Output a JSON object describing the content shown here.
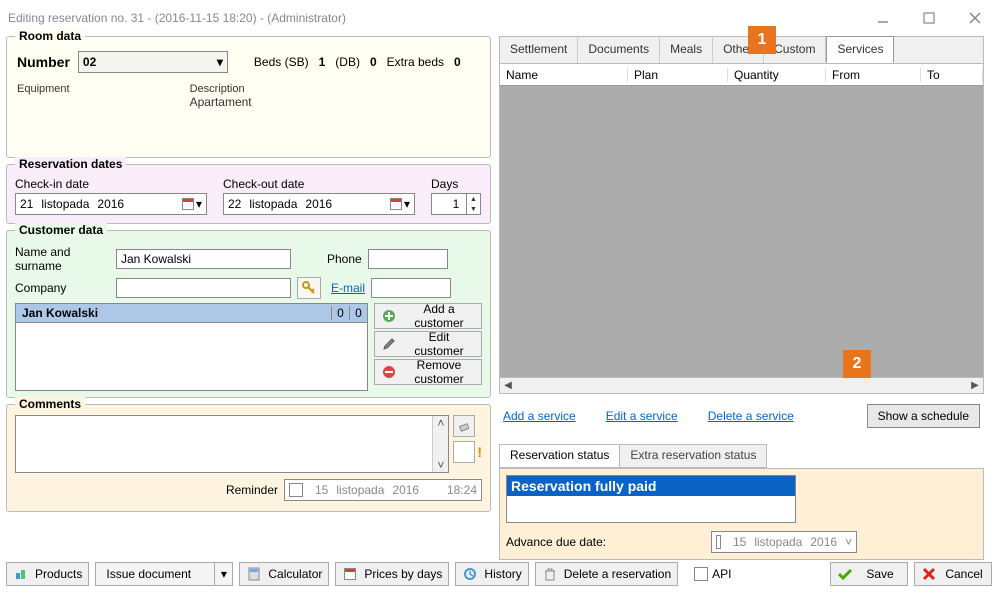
{
  "window": {
    "title": "Editing reservation no. 31 - (2016-11-15 18:20) - (Administrator)"
  },
  "annotations": {
    "a1": "1",
    "a2": "2"
  },
  "room": {
    "legend": "Room data",
    "number_label": "Number",
    "number_value": "02",
    "beds_sb_label": "Beds (SB)",
    "beds_sb_value": "1",
    "beds_db_label": "(DB)",
    "beds_db_value": "0",
    "extra_beds_label": "Extra beds",
    "extra_beds_value": "0",
    "equipment_label": "Equipment",
    "description_label": "Description",
    "description_value": "Apartament"
  },
  "dates": {
    "legend": "Reservation dates",
    "checkin_label": "Check-in date",
    "checkin_day": "21",
    "checkin_month": "listopada",
    "checkin_year": "2016",
    "checkout_label": "Check-out date",
    "checkout_day": "22",
    "checkout_month": "listopada",
    "checkout_year": "2016",
    "days_label": "Days",
    "days_value": "1"
  },
  "customer": {
    "legend": "Customer data",
    "name_label": "Name and surname",
    "name_value": "Jan Kowalski",
    "company_label": "Company",
    "phone_label": "Phone",
    "email_label": "E-mail",
    "selected_name": "Jan Kowalski",
    "selected_v1": "0",
    "selected_v2": "0",
    "btn_add": "Add a customer",
    "btn_edit": "Edit customer",
    "btn_remove": "Remove customer"
  },
  "comments": {
    "legend": "Comments",
    "reminder_label": "Reminder",
    "reminder_day": "15",
    "reminder_month": "listopada",
    "reminder_year": "2016",
    "reminder_time": "18:24"
  },
  "tabs": {
    "settlement": "Settlement",
    "documents": "Documents",
    "meals": "Meals",
    "other": "Other",
    "custom": "Custom",
    "services": "Services"
  },
  "services": {
    "col_name": "Name",
    "col_plan": "Plan",
    "col_quantity": "Quantity",
    "col_from": "From",
    "col_to": "To",
    "add_link": "Add a service",
    "edit_link": "Edit a service",
    "delete_link": "Delete a service",
    "schedule_btn": "Show a schedule"
  },
  "status": {
    "tab1": "Reservation status",
    "tab2": "Extra reservation status",
    "item": "Reservation fully paid",
    "advance_label": "Advance due date:",
    "advance_day": "15",
    "advance_month": "listopada",
    "advance_year": "2016"
  },
  "footer": {
    "products": "Products",
    "issue_doc": "Issue document",
    "calculator": "Calculator",
    "prices": "Prices by days",
    "history": "History",
    "delete_res": "Delete a reservation",
    "api": "API",
    "save": "Save",
    "cancel": "Cancel"
  }
}
